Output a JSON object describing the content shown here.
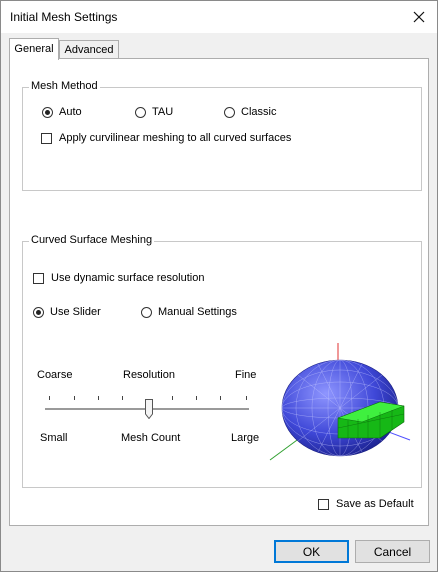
{
  "window": {
    "title": "Initial Mesh Settings"
  },
  "tabs": [
    {
      "label": "General"
    },
    {
      "label": "Advanced"
    }
  ],
  "mesh_method": {
    "label": "Mesh Method",
    "options": [
      {
        "label": "Auto",
        "selected": true
      },
      {
        "label": "TAU",
        "selected": false
      },
      {
        "label": "Classic",
        "selected": false
      }
    ],
    "curvilinear_label": "Apply curvilinear meshing to all curved surfaces",
    "curvilinear_checked": false
  },
  "curved_surface": {
    "label": "Curved Surface Meshing",
    "dynamic_label": "Use dynamic surface resolution",
    "dynamic_checked": false,
    "mode_options": [
      {
        "label": "Use Slider",
        "selected": true
      },
      {
        "label": "Manual Settings",
        "selected": false
      }
    ],
    "slider": {
      "top_labels": {
        "left": "Coarse",
        "center": "Resolution",
        "right": "Fine"
      },
      "bottom_labels": {
        "left": "Small",
        "center": "Mesh Count",
        "right": "Large"
      },
      "value_fraction": 0.5
    }
  },
  "save_default_label": "Save as Default",
  "save_default_checked": false,
  "buttons": {
    "ok": "OK",
    "cancel": "Cancel"
  },
  "colors": {
    "sphere": "#3f48d8",
    "ring": "#22dd22",
    "axis_x": "#5050ff",
    "axis_y": "#e03030",
    "axis_z": "#30a030"
  }
}
